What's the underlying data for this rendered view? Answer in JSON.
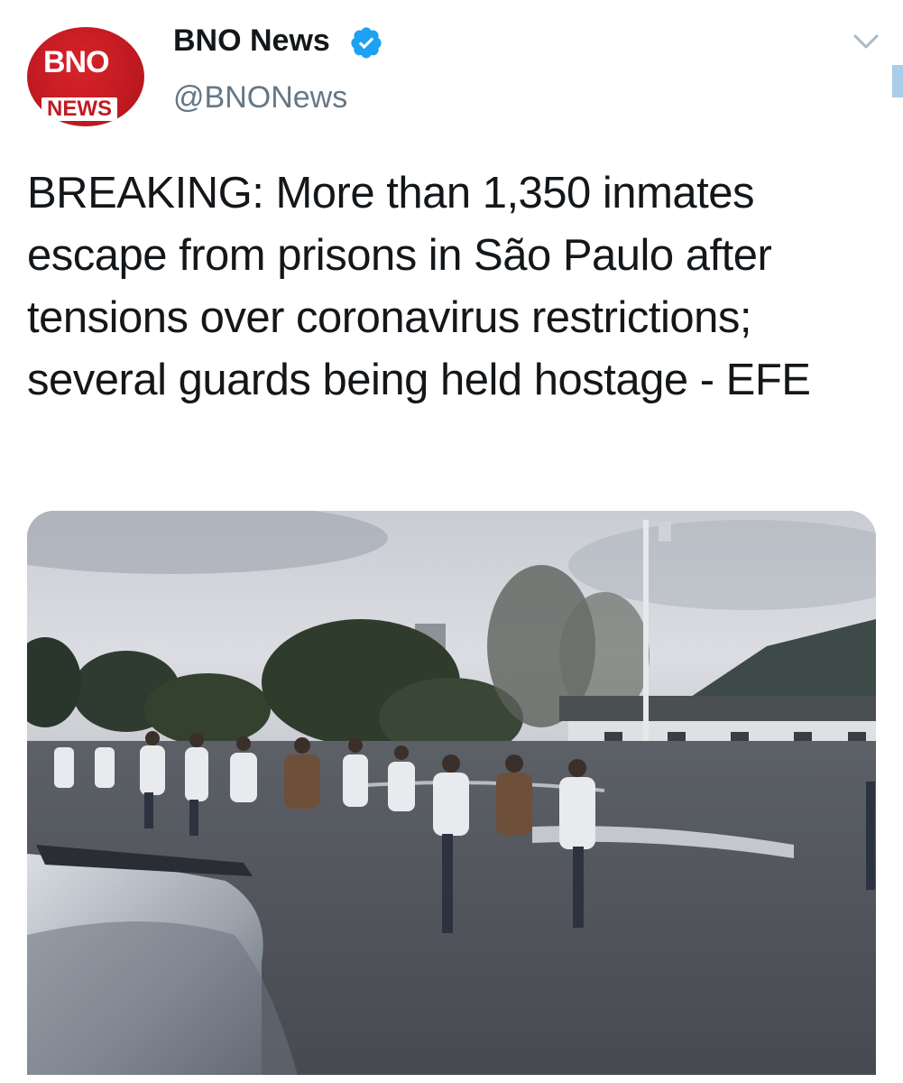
{
  "account": {
    "avatar_logo_top": "BNO",
    "avatar_logo_bottom": "NEWS",
    "display_name": "BNO News",
    "handle": "@BNONews",
    "verified": true
  },
  "tweet": {
    "text": "BREAKING: More than 1,350 inmates escape from prisons in São Paulo after tensions over coronavirus restrictions; several guards being held hostage - EFE"
  },
  "icons": {
    "verified": "verified-badge-icon",
    "menu": "chevron-down-icon"
  },
  "colors": {
    "brand_red": "#c11a21",
    "verified_blue": "#1da1f2",
    "text": "#14171a",
    "handle_gray": "#657786"
  }
}
